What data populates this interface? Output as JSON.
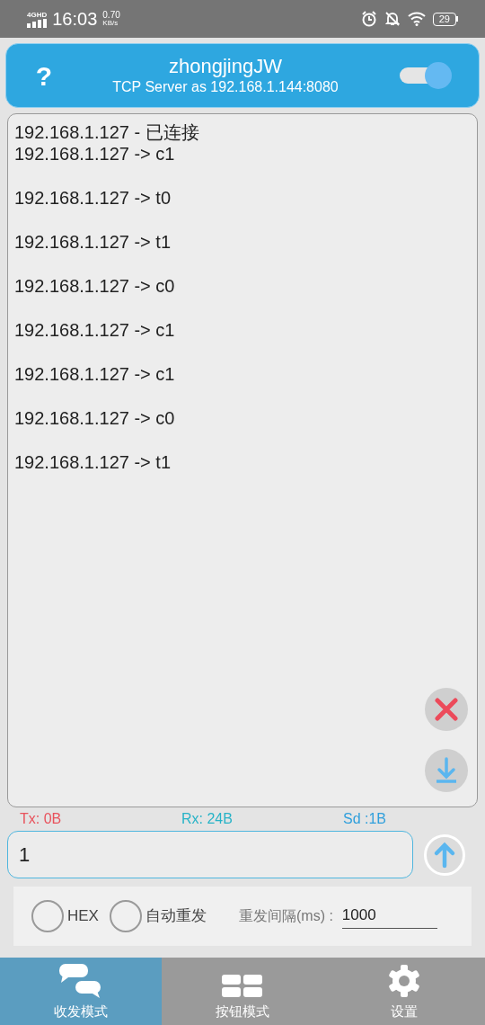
{
  "status_bar": {
    "network": "4GHD",
    "time": "16:03",
    "speed_value": "0.70",
    "speed_unit": "KB/s",
    "battery": "29"
  },
  "header": {
    "title": "zhongjingJW",
    "subtitle": "TCP Server as 192.168.1.144:8080",
    "help": "?",
    "server_on": true
  },
  "log": [
    {
      "kind": "status",
      "text": "192.168.1.127 - 已连接"
    },
    {
      "kind": "data",
      "text": "192.168.1.127 -> c1"
    },
    {
      "kind": "data",
      "text": "192.168.1.127 -> t0"
    },
    {
      "kind": "data",
      "text": "192.168.1.127 -> t1"
    },
    {
      "kind": "data",
      "text": "192.168.1.127 -> c0"
    },
    {
      "kind": "data",
      "text": "192.168.1.127 -> c1"
    },
    {
      "kind": "data",
      "text": "192.168.1.127 -> c1"
    },
    {
      "kind": "data",
      "text": "192.168.1.127 -> c0"
    },
    {
      "kind": "data",
      "text": "192.168.1.127 -> t1"
    }
  ],
  "counters": {
    "tx": "Tx: 0B",
    "rx": "Rx: 24B",
    "sd": "Sd :1B"
  },
  "send_field": {
    "value": "1"
  },
  "options": {
    "hex": {
      "label": "HEX",
      "checked": false
    },
    "auto_resend": {
      "label": "自动重发",
      "checked": false
    },
    "interval_label": "重发间隔(ms) :",
    "interval_value": "1000"
  },
  "tabs": [
    {
      "kind": "chat",
      "label": "收发模式",
      "selected": true
    },
    {
      "kind": "grid",
      "label": "按钮模式",
      "selected": false
    },
    {
      "kind": "gear",
      "label": "设置",
      "selected": false
    }
  ]
}
